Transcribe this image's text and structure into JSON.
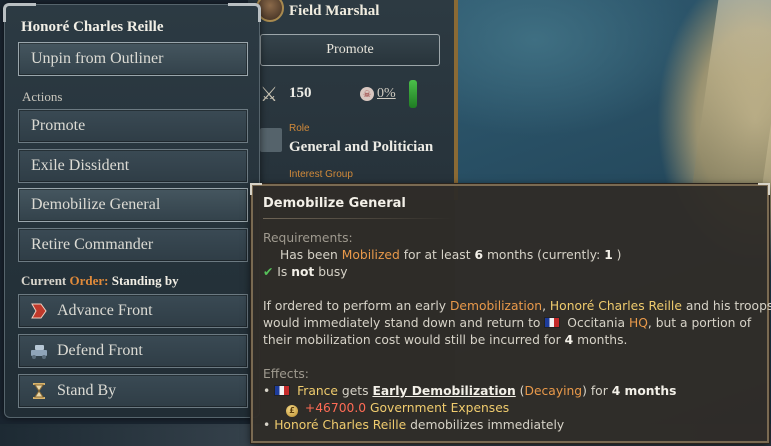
{
  "character_panel": {
    "rank": "Field Marshal",
    "promote_label": "Promote",
    "troops": "150",
    "casualty_pct": "0%",
    "role_label": "Role",
    "role_value": "General and Politician",
    "interest_group_label": "Interest Group"
  },
  "menu": {
    "title": "Honoré Charles Reille",
    "unpin_label": "Unpin from Outliner",
    "actions_heading": "Actions",
    "actions": [
      {
        "label": "Promote"
      },
      {
        "label": "Exile Dissident"
      },
      {
        "label": "Demobilize General"
      },
      {
        "label": "Retire Commander"
      }
    ],
    "order_prefix": "Current",
    "order_word": "Order:",
    "order_value": "Standing by",
    "orders": [
      {
        "label": "Advance Front",
        "icon": "advance-front-icon"
      },
      {
        "label": "Defend Front",
        "icon": "defend-front-icon"
      },
      {
        "label": "Stand By",
        "icon": "stand-by-icon"
      }
    ]
  },
  "tooltip": {
    "title": "Demobilize General",
    "requirements_heading": "Requirements:",
    "req1_pre": "Has been",
    "req1_kw": "Mobilized",
    "req1_mid": "for at least",
    "req1_num": "6",
    "req1_post": "months (currently:",
    "req1_cur": "1",
    "req1_end": ")",
    "req2_pre": "Is",
    "req2_kw": "not",
    "req2_post": "busy",
    "para_a": "If ordered to perform an early",
    "para_kw1": "Demobilization",
    "para_sep": ",",
    "para_name": "Honoré Charles Reille",
    "para_b": "and his troops",
    "para_c": "would immediately stand down and return to",
    "para_place": "Occitania",
    "para_hq": "HQ",
    "para_d": ", but a portion of",
    "para_e": "their mobilization cost would still be incurred for",
    "para_num": "4",
    "para_f": "months.",
    "effects_heading": "Effects:",
    "eff1_country": "France",
    "eff1_gets": "gets",
    "eff1_mod": "Early Demobilization",
    "eff1_state": "Decaying",
    "eff1_for": "for",
    "eff1_dur": "4 months",
    "eff2_amount": "+46700.0",
    "eff2_label": "Government Expenses",
    "eff3_name": "Honoré Charles Reille",
    "eff3_post": "demobilizes immediately"
  },
  "colors": {
    "accent_orange": "#e9994a",
    "keyword_yellow": "#f0cc6e",
    "negative_red": "#ff6b55",
    "check_green": "#56c15a"
  }
}
